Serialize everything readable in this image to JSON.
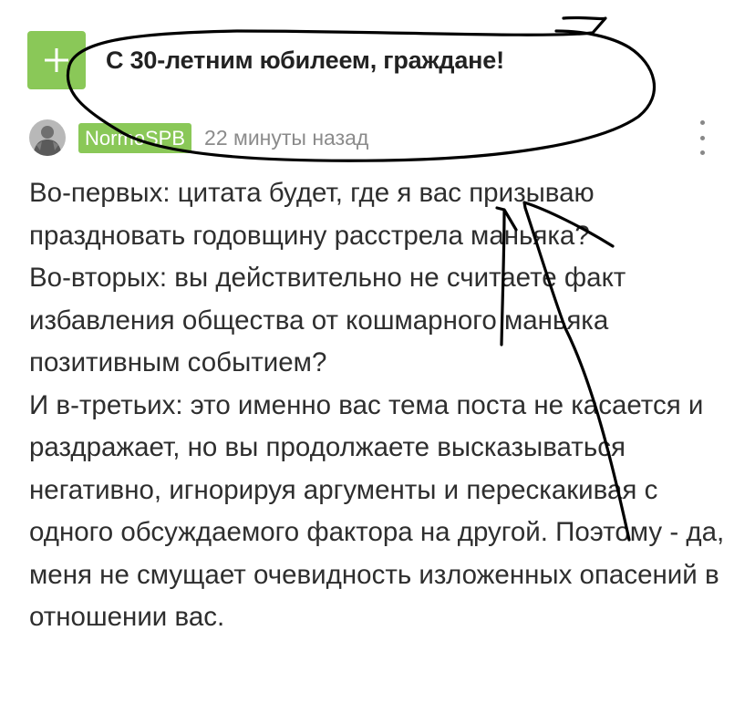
{
  "post": {
    "add_button_label": "+",
    "title": "С 30-летним юбилеем, граждане!"
  },
  "comment": {
    "username": "NormoSPB",
    "time": "22 минуты назад",
    "paragraphs": [
      "Во-первых: цитата будет, где я вас призываю праздновать годовщину расстрела маньяка?",
      "Во-вторых: вы действительно не считаете факт избавления общества от кошмарного маньяка позитивным событием?",
      "И в-третьих: это именно вас тема поста не касается и раздражает, но вы продолжаете высказываться негативно, игнорируя аргументы и перескакивая с одного обсуждаемого фактора на другой. Поэтому - да, меня не смущает очевидность изложенных опасений в отношении вас."
    ]
  },
  "colors": {
    "accent_green": "#8ac858",
    "meta_gray": "#8b8b8b",
    "text": "#2e2e2e",
    "annotation_ink": "#000000"
  },
  "icons": {
    "add": "plus-icon",
    "more": "vertical-dots-icon",
    "avatar": "user-avatar-image"
  }
}
